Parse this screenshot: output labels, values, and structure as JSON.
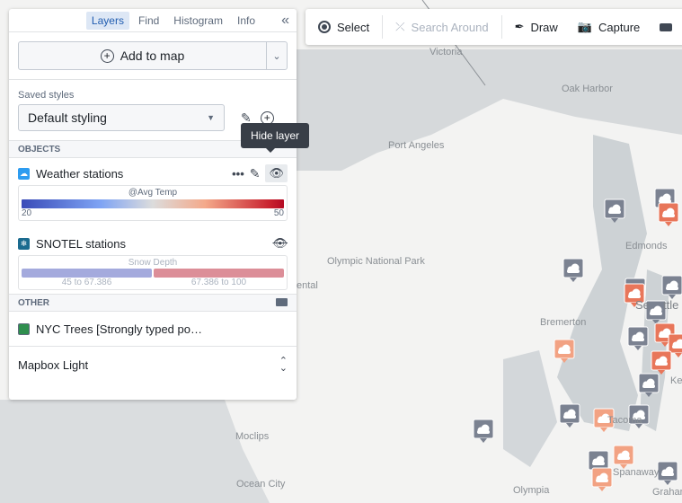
{
  "panel": {
    "tabs": [
      {
        "label": "Layers",
        "active": true
      },
      {
        "label": "Find"
      },
      {
        "label": "Histogram"
      },
      {
        "label": "Info"
      }
    ],
    "collapse_icon": "double-chevron-left-icon",
    "add_to_map": "Add to map",
    "saved_styles_label": "Saved styles",
    "saved_style_value": "Default styling",
    "objects_header": "OBJECTS",
    "other_header": "OTHER",
    "layers": [
      {
        "name": "Weather stations",
        "icon": "cloud-icon",
        "icon_color": "#2d9cf0",
        "visible": true,
        "legend": {
          "title": "@Avg Temp",
          "min": "20",
          "max": "50"
        }
      },
      {
        "name": "SNOTEL stations",
        "icon": "snowflake-icon",
        "icon_color": "#1b6b8f",
        "visible": false,
        "legend": {
          "title": "Snow Depth",
          "bins": [
            {
              "label": "45 to 67.386",
              "color": "#a4aadd"
            },
            {
              "label": "67.386 to 100",
              "color": "#dc8e98"
            }
          ]
        }
      }
    ],
    "other_layers": [
      {
        "name": "NYC Trees [Strongly typed po…",
        "icon": "map-icon"
      }
    ],
    "basemap": "Mapbox Light",
    "tooltip": "Hide layer"
  },
  "toolbar": {
    "select": "Select",
    "search_around": "Search Around",
    "draw": "Draw",
    "capture": "Capture"
  },
  "map": {
    "labels": [
      "Victoria",
      "Oak Harbor",
      "Port Angeles",
      "Olympic National Park",
      "ental",
      "Edmonds",
      "Bremerton",
      "Se",
      "ttle",
      "Ke",
      "Tacoma",
      "Moclips",
      "Ocean City",
      "Olympia",
      "Spanaway",
      "Grahan"
    ],
    "marker_colors": {
      "grey": "#7b8291",
      "orange": "#e8765a",
      "light_orange": "#f2a283"
    }
  }
}
